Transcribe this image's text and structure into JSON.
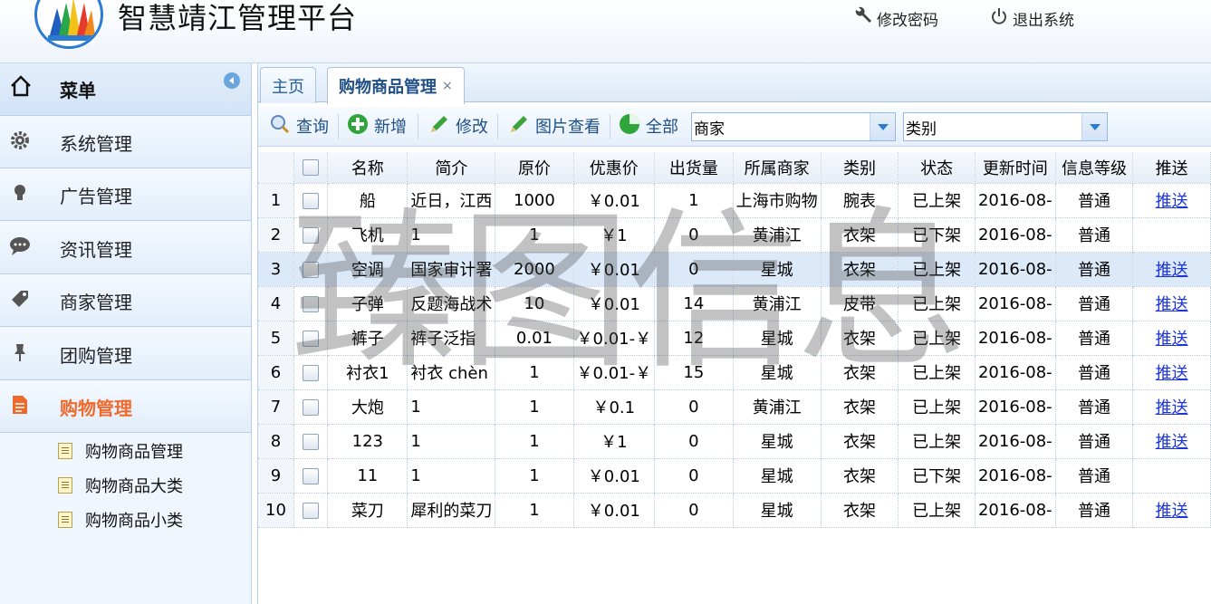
{
  "header": {
    "title": "智慧靖江管理平台",
    "change_password": "修改密码",
    "logout": "退出系统"
  },
  "sidebar": {
    "menu_label": "菜单",
    "items": [
      {
        "label": "系统管理",
        "icon": "gear-icon"
      },
      {
        "label": "广告管理",
        "icon": "lightbulb-icon"
      },
      {
        "label": "资讯管理",
        "icon": "speech-bubble-icon"
      },
      {
        "label": "商家管理",
        "icon": "tag-icon"
      },
      {
        "label": "团购管理",
        "icon": "pin-icon"
      },
      {
        "label": "购物管理",
        "icon": "document-icon"
      }
    ],
    "sub_items": [
      "购物商品管理",
      "购物商品大类",
      "购物商品小类"
    ]
  },
  "tabs": [
    {
      "label": "主页"
    },
    {
      "label": "购物商品管理",
      "close": "×"
    }
  ],
  "toolbar": {
    "query": "查询",
    "add": "新增",
    "edit": "修改",
    "image_view": "图片查看",
    "all": "全部",
    "merchant_combo": "商家",
    "category_combo": "类别"
  },
  "table": {
    "headers": [
      "名称",
      "简介",
      "原价",
      "优惠价",
      "出货量",
      "所属商家",
      "类别",
      "状态",
      "更新时间",
      "信息等级",
      "推送"
    ],
    "rows": [
      [
        "1",
        "船",
        "近日，江西",
        "1000",
        "￥0.01",
        "1",
        "上海市购物",
        "腕表",
        "已上架",
        "2016-08-",
        "普通",
        "推送"
      ],
      [
        "2",
        "飞机",
        "1",
        "1",
        "￥1",
        "0",
        "黄浦江",
        "衣架",
        "已下架",
        "2016-08-",
        "普通",
        ""
      ],
      [
        "3",
        "空调",
        "国家审计署",
        "2000",
        "￥0.01",
        "0",
        "星城",
        "衣架",
        "已上架",
        "2016-08-",
        "普通",
        "推送"
      ],
      [
        "4",
        "子弹",
        "反题海战术",
        "10",
        "￥0.01",
        "14",
        "黄浦江",
        "皮带",
        "已上架",
        "2016-08-",
        "普通",
        "推送"
      ],
      [
        "5",
        "裤子",
        "裤子泛指",
        "0.01",
        "￥0.01-￥",
        "12",
        "星城",
        "衣架",
        "已上架",
        "2016-08-",
        "普通",
        "推送"
      ],
      [
        "6",
        "衬衣1",
        "衬衣 chèn",
        "1",
        "￥0.01-￥",
        "15",
        "星城",
        "衣架",
        "已上架",
        "2016-08-",
        "普通",
        "推送"
      ],
      [
        "7",
        "大炮",
        "1",
        "1",
        "￥0.1",
        "0",
        "黄浦江",
        "衣架",
        "已上架",
        "2016-08-",
        "普通",
        "推送"
      ],
      [
        "8",
        "123",
        "1",
        "1",
        "￥1",
        "0",
        "星城",
        "衣架",
        "已上架",
        "2016-08-",
        "普通",
        "推送"
      ],
      [
        "9",
        "11",
        "1",
        "1",
        "￥0.01",
        "0",
        "星城",
        "衣架",
        "已下架",
        "2016-08-",
        "普通",
        ""
      ],
      [
        "10",
        "菜刀",
        "犀利的菜刀",
        "1",
        "￥0.01",
        "0",
        "星城",
        "衣架",
        "已上架",
        "2016-08-",
        "普通",
        "推送"
      ]
    ],
    "selected_row": 3
  },
  "watermark": "臻图信息",
  "colors": {
    "accent": "#2c7bd2",
    "active_menu": "#ee6a2c",
    "link": "#1b34d9"
  }
}
